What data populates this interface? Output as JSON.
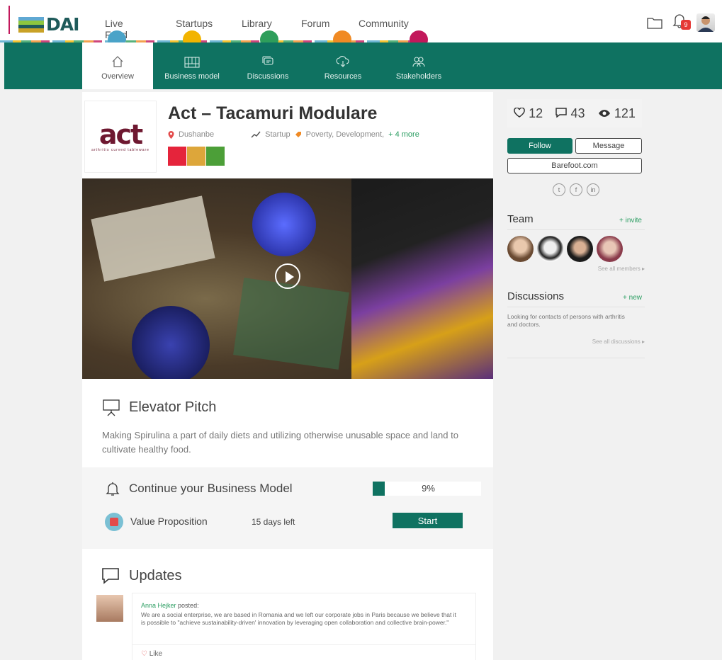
{
  "brand": {
    "logo_text": "DAI"
  },
  "topnav": {
    "items": [
      "Live Feed",
      "Startups",
      "Library",
      "Forum",
      "Community"
    ],
    "notification_count": "9"
  },
  "colors": {
    "primary": "#0f7261",
    "accent_green": "#2a9d61",
    "dots": [
      "#4aa3c8",
      "#f2b400",
      "#2e9e5b",
      "#f08a24",
      "#c2185b"
    ]
  },
  "subnav": {
    "tabs": [
      {
        "label": "Overview",
        "icon": "home-icon",
        "active": true
      },
      {
        "label": "Business model",
        "icon": "canvas-icon"
      },
      {
        "label": "Discussions",
        "icon": "chat-icon"
      },
      {
        "label": "Resources",
        "icon": "cloud-download-icon"
      },
      {
        "label": "Stakeholders",
        "icon": "people-icon"
      }
    ]
  },
  "startup": {
    "logo_text": "act",
    "logo_subtext": "arthritis   curved   tableware",
    "title": "Act – Tacamuri Modulare",
    "location": "Dushanbe",
    "type": "Startup",
    "tags": "Poverty, Development,",
    "more_tags": "+ 4 more"
  },
  "pitch": {
    "title": "Elevator Pitch",
    "text": "Making Spirulina a part of daily diets and utilizing otherwise unusable space and land to cultivate healthy food."
  },
  "business_model": {
    "title": "Continue your Business Model",
    "progress_value": 9,
    "progress_text": "9%",
    "item_label": "Value Proposition",
    "days_left": "15 days left",
    "start_label": "Start"
  },
  "updates": {
    "title": "Updates",
    "post": {
      "author": "Anna Hejker",
      "posted": "posted:",
      "text": "We are a social enterprise, we are based in Romania and we left our corporate jobs in Paris because we believe that it is possible to \"achieve sustainability-driven' innovation by leveraging open collaboration and collective brain-power.\"",
      "like_label": "Like"
    }
  },
  "sidebar": {
    "likes": "12",
    "comments": "43",
    "views": "121",
    "follow_label": "Follow",
    "message_label": "Message",
    "website": "Barefoot.com",
    "socials": [
      "twitter-icon",
      "facebook-icon",
      "linkedin-icon"
    ],
    "team": {
      "title": "Team",
      "action": "+ invite",
      "see_all": "See all members ▸"
    },
    "discussions": {
      "title": "Discussions",
      "action": "+ new",
      "item": "Looking for contacts of persons with arthritis and doctors.",
      "see_all": "See all discussions ▸"
    }
  }
}
